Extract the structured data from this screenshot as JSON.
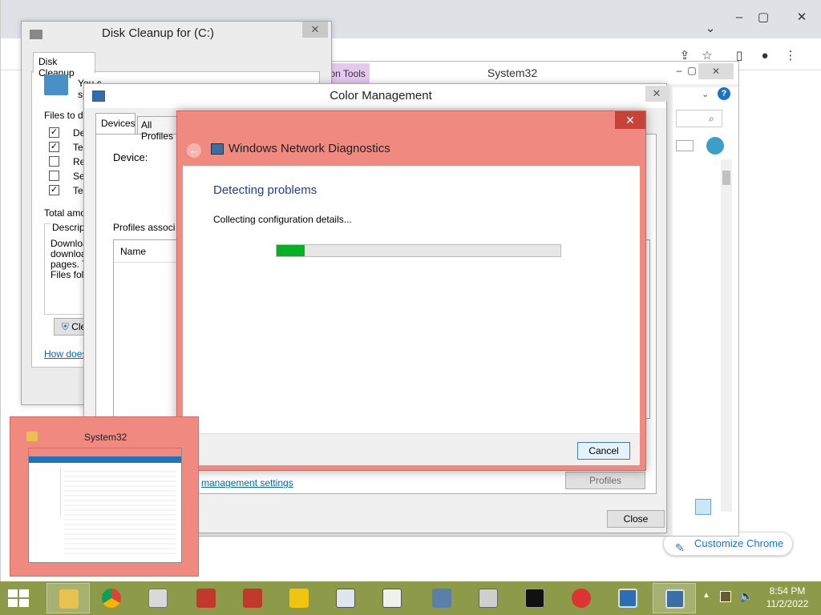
{
  "disk_cleanup": {
    "title": "Disk Cleanup for  (C:)",
    "tab": "Disk Cleanup",
    "intro": "You c",
    "intro2": "sp",
    "files_label": "Files to del",
    "files": [
      {
        "label": "De",
        "checked": true
      },
      {
        "label": "Te",
        "checked": true
      },
      {
        "label": "Re",
        "checked": false
      },
      {
        "label": "Se",
        "checked": false
      },
      {
        "label": "Te",
        "checked": true
      }
    ],
    "total": "Total amou",
    "description_label": "Descripti",
    "description_lines": [
      "Downloa",
      "downloa",
      "pages. T",
      "Files fold"
    ],
    "cleanup_button": "Cle",
    "help_link": "How does"
  },
  "explorer": {
    "app_tools": "Application Tools",
    "title": "System32"
  },
  "color_management": {
    "title": "Color Management",
    "tabs": [
      "Devices",
      "All Profiles"
    ],
    "device_label": "Device:",
    "profiles_label": "Profiles associ",
    "column_name": "Name",
    "settings_link": "management settings",
    "profiles_button": "Profiles",
    "close_button": "Close"
  },
  "network_diagnostics": {
    "title": "Windows Network Diagnostics",
    "heading": "Detecting problems",
    "status": "Collecting configuration details...",
    "progress": 0.1,
    "cancel": "Cancel"
  },
  "chrome": {
    "customize": "Customize Chrome"
  },
  "thumbnail": {
    "title": "System32"
  },
  "taskbar": {
    "time": "8:54 PM",
    "date": "11/2/2022"
  },
  "colors": {
    "accent": "#f08a80",
    "progress": "#06b025",
    "heading": "#1c3f95",
    "link": "#0066cc"
  }
}
